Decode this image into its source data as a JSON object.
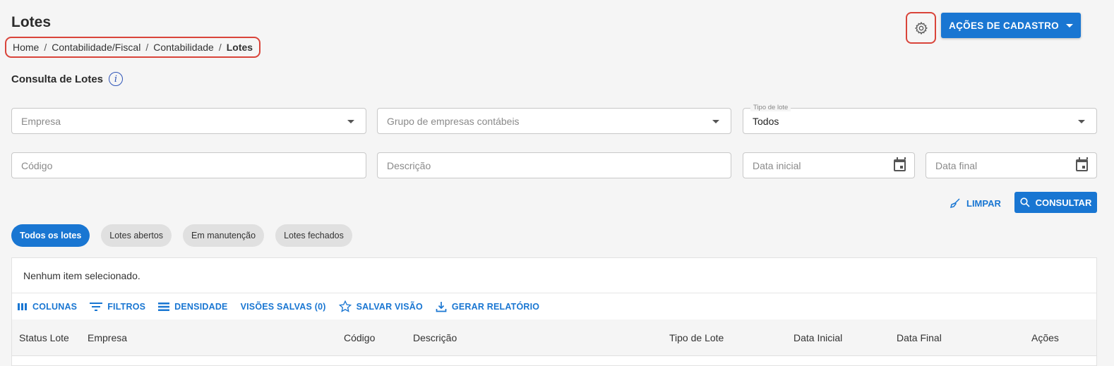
{
  "header": {
    "title": "Lotes",
    "breadcrumb": [
      "Home",
      "Contabilidade/Fiscal",
      "Contabilidade",
      "Lotes"
    ],
    "actions_label": "AÇÕES DE CADASTRO"
  },
  "section": {
    "title": "Consulta de Lotes",
    "info_glyph": "i"
  },
  "filters": {
    "empresa_placeholder": "Empresa",
    "grupo_placeholder": "Grupo de empresas contábeis",
    "tipo_label": "Tipo de lote",
    "tipo_value": "Todos",
    "codigo_placeholder": "Código",
    "descricao_placeholder": "Descrição",
    "data_inicial_placeholder": "Data inicial",
    "data_final_placeholder": "Data final",
    "limpar_label": "LIMPAR",
    "consultar_label": "CONSULTAR"
  },
  "chips": [
    {
      "label": "Todos os lotes",
      "active": true
    },
    {
      "label": "Lotes abertos",
      "active": false
    },
    {
      "label": "Em manutenção",
      "active": false
    },
    {
      "label": "Lotes fechados",
      "active": false
    }
  ],
  "grid": {
    "selection_text": "Nenhum item selecionado.",
    "toolbar": {
      "colunas": "COLUNAS",
      "filtros": "FILTROS",
      "densidade": "DENSIDADE",
      "visoes": "VISÕES SALVAS (0)",
      "salvar": "SALVAR VISÃO",
      "relatorio": "GERAR RELATÓRIO"
    },
    "columns": [
      "Status Lote",
      "Empresa",
      "Código",
      "Descrição",
      "Tipo de Lote",
      "Data Inicial",
      "Data Final",
      "Ações"
    ]
  },
  "colors": {
    "primary": "#1976d2",
    "highlight": "#d9443a"
  }
}
